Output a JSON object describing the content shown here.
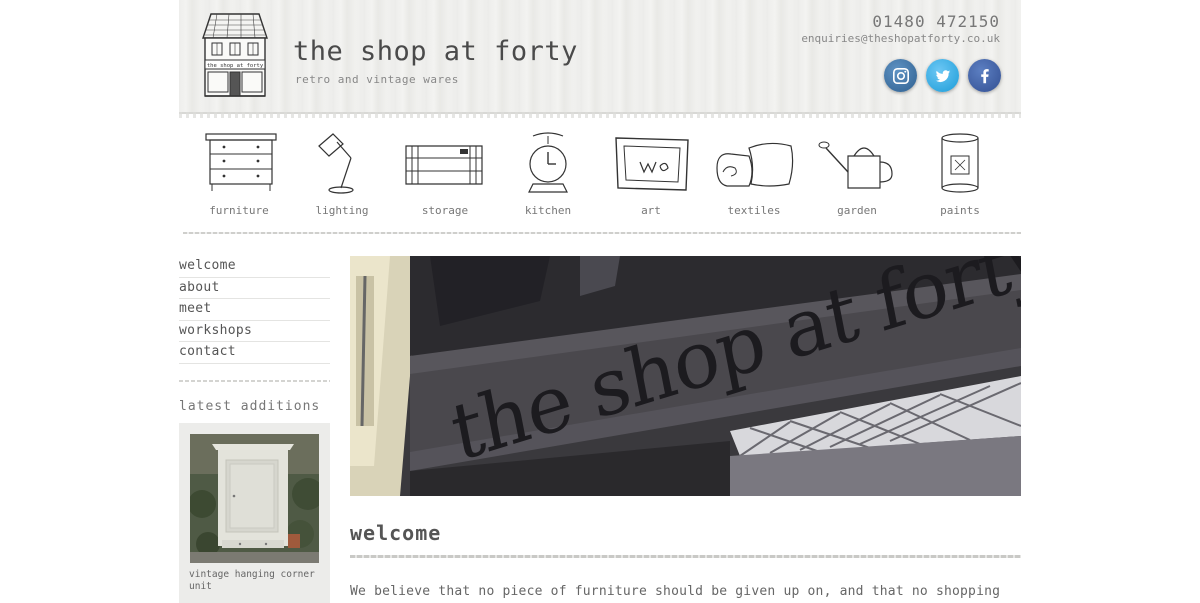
{
  "header": {
    "title": "the shop at forty",
    "tagline": "retro and vintage wares",
    "phone": "01480 472150",
    "email": "enquiries@theshopatforty.co.uk",
    "house_sign": "the shop at forty",
    "social": [
      {
        "name": "instagram",
        "icon": "instagram-icon",
        "color": "#3b6fa0"
      },
      {
        "name": "twitter",
        "icon": "twitter-icon",
        "color": "#29a9e1"
      },
      {
        "name": "facebook",
        "icon": "facebook-icon",
        "color": "#3b5998"
      }
    ]
  },
  "categories": [
    {
      "label": "furniture",
      "icon": "chest-of-drawers-icon"
    },
    {
      "label": "lighting",
      "icon": "desk-lamp-icon"
    },
    {
      "label": "storage",
      "icon": "crate-icon"
    },
    {
      "label": "kitchen",
      "icon": "kitchen-scale-icon"
    },
    {
      "label": "art",
      "icon": "picture-frame-icon"
    },
    {
      "label": "textiles",
      "icon": "cushion-icon"
    },
    {
      "label": "garden",
      "icon": "watering-can-icon"
    },
    {
      "label": "paints",
      "icon": "paint-tin-icon"
    }
  ],
  "sidebar": {
    "menu": [
      "welcome",
      "about",
      "meet",
      "workshops",
      "contact"
    ],
    "latest_title": "latest additions",
    "latest_caption": "vintage hanging corner unit"
  },
  "main": {
    "hero_sign": "the shop at forty",
    "heading": "welcome",
    "intro": "We believe that no piece of furniture should be given up on, and that no shopping"
  },
  "colors": {
    "text": "#555555",
    "header_bg": "#eeeeec",
    "sidebar_box": "#ececea",
    "hero_fascia": "#3b3a3e"
  }
}
